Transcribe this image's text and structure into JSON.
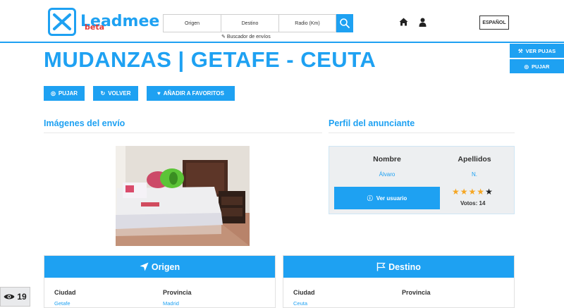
{
  "header": {
    "logo_text": "Leadmee",
    "logo_badge": "beta",
    "search": {
      "origen": "Origen",
      "destino": "Destino",
      "radio": "Radio (Km)",
      "hint": "Buscador de envíos"
    },
    "language": "ESPAÑOL"
  },
  "side_buttons": {
    "ver_pujas": "VER PUJAS",
    "pujar": "PUJAR"
  },
  "page": {
    "title": "MUDANZAS | GETAFE - CEUTA",
    "actions": {
      "pujar": "PUJAR",
      "volver": "VOLVER",
      "favoritos": "AÑADIR A FAVORITOS"
    }
  },
  "images_section": {
    "heading": "Imágenes del envío"
  },
  "profile": {
    "heading": "Perfil del anunciante",
    "nombre_label": "Nombre",
    "apellidos_label": "Apellidos",
    "nombre": "Álvaro",
    "apellidos": "N.",
    "ver_usuario": "Ver usuario",
    "rating": 4,
    "rating_max": 5,
    "votos": "Votos: 14"
  },
  "origen": {
    "title": "Origen",
    "ciudad_label": "Ciudad",
    "provincia_label": "Provincia",
    "ciudad": "Getafe",
    "provincia": "Madrid"
  },
  "destino": {
    "title": "Destino",
    "ciudad_label": "Ciudad",
    "provincia_label": "Provincia",
    "ciudad": "Ceuta",
    "provincia": ""
  },
  "views_count": "19",
  "colors": {
    "accent": "#1ea1f2",
    "badge": "#e53935",
    "star": "#f5a623"
  }
}
